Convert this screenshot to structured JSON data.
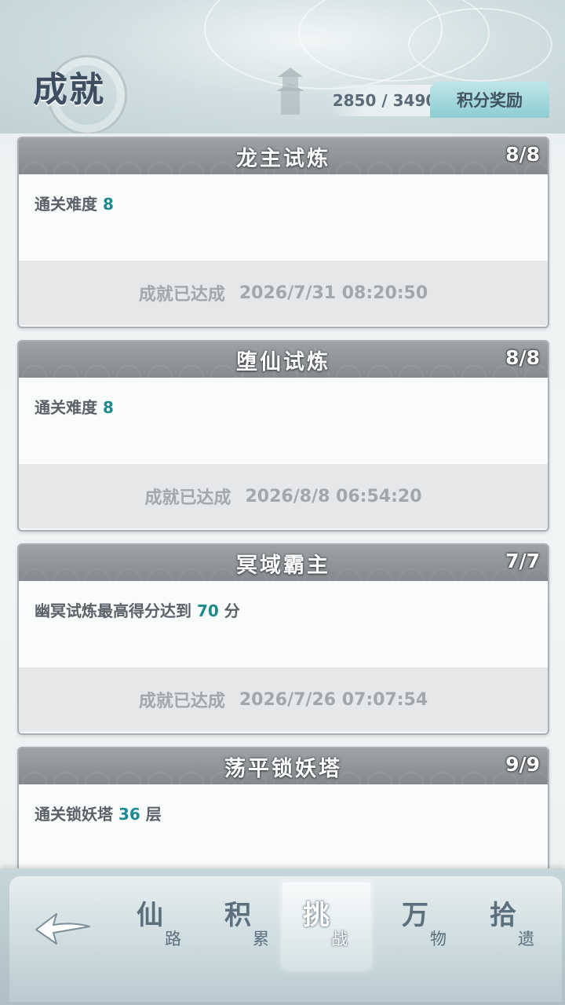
{
  "header": {
    "title": "成就",
    "score": "2850 / 3490",
    "reward_button": "积分奖励"
  },
  "achievements": [
    {
      "title": "龙主试炼",
      "count": "8/8",
      "desc_prefix": "通关难度 ",
      "desc_value": "8",
      "desc_suffix": "",
      "status": "成就已达成",
      "date": "2026/7/31 08:20:50"
    },
    {
      "title": "堕仙试炼",
      "count": "8/8",
      "desc_prefix": "通关难度 ",
      "desc_value": "8",
      "desc_suffix": "",
      "status": "成就已达成",
      "date": "2026/8/8 06:54:20"
    },
    {
      "title": "冥域霸主",
      "count": "7/7",
      "desc_prefix": "幽冥试炼最高得分达到 ",
      "desc_value": "70",
      "desc_suffix": " 分",
      "status": "成就已达成",
      "date": "2026/7/26 07:07:54"
    },
    {
      "title": "荡平锁妖塔",
      "count": "9/9",
      "desc_prefix": "通关锁妖塔 ",
      "desc_value": "36",
      "desc_suffix": " 层",
      "status": "",
      "date": ""
    }
  ],
  "nav": {
    "back_icon": "back-arrow-icon",
    "tabs": [
      {
        "big": "仙",
        "small": "路",
        "active": false
      },
      {
        "big": "积",
        "small": "累",
        "active": false
      },
      {
        "big": "挑",
        "small": "战",
        "active": true
      },
      {
        "big": "万",
        "small": "物",
        "active": false
      },
      {
        "big": "拾",
        "small": "遗",
        "active": false
      }
    ]
  }
}
